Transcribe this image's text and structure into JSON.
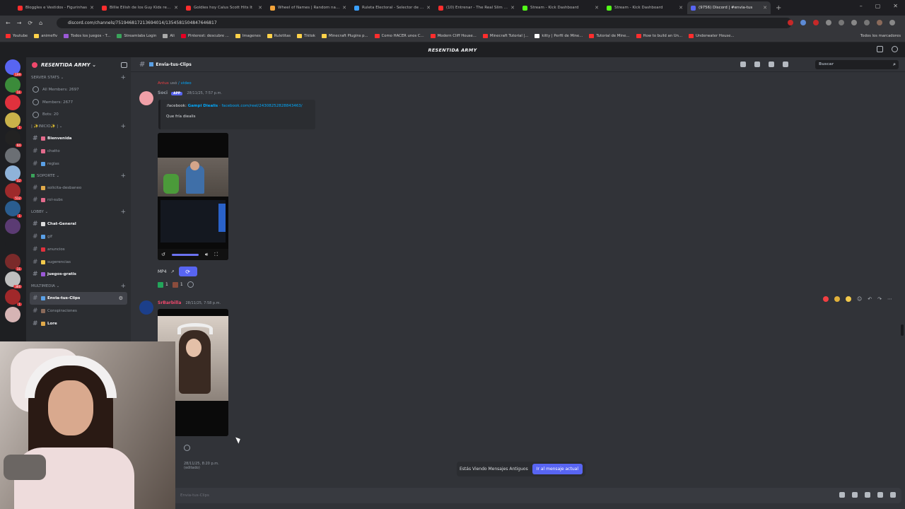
{
  "browser": {
    "tabs": [
      {
        "title": "Bloggles e Vestidos - Figurinhas",
        "color": "#ff2d2d",
        "active": false
      },
      {
        "title": "Billie Eilish de los Guy Kids regalo",
        "color": "#ff2d2d",
        "active": false
      },
      {
        "title": "Goldies hoy Calus Scott Hits It",
        "color": "#ff2d2d",
        "active": false
      },
      {
        "title": "Wheel of Names | Random name",
        "color": "#f2a33a",
        "active": false
      },
      {
        "title": "Ruleta Electoral - Selector de Persona",
        "color": "#3aa0ff",
        "active": false
      },
      {
        "title": "(10) Entrenar - The Real Slim Sh",
        "color": "#ff2d2d",
        "active": false
      },
      {
        "title": "Stream - Kick Dashboard",
        "color": "#53fc18",
        "active": false
      },
      {
        "title": "Stream - Kick Dashboard",
        "color": "#53fc18",
        "active": false
      },
      {
        "title": "(9756) Discord | #envia-tus",
        "color": "#5865f2",
        "active": true
      }
    ],
    "url": "discord.com/channels/751946817213694014/1354581504847646817",
    "bookmarks": [
      "Youtube",
      "animeflv",
      "Todos los juegos - T...",
      "Streamlabs Login",
      "Ali",
      "Pinterest: descubre ...",
      "Imagenes",
      "Ruletitas",
      "Tiktok",
      "Minecraft Plugins p...",
      "Como HACER unos C...",
      "Modern Cliff House...",
      "Minecraft Tutorial |...",
      "kitty | Perfil de Mine...",
      "Tutorial de Mine...",
      "How to build an Un...",
      "Underwater House..."
    ],
    "bookmarks_all": "Todos los marcadores"
  },
  "app": {
    "title": "RESENTIDA ARMY"
  },
  "servers": [
    {
      "color": "#5865f2",
      "badge": "199"
    },
    {
      "color": "#3b8b3a",
      "badge": "11"
    },
    {
      "color": "#e0313d",
      "badge": ""
    },
    {
      "color": "#c9b24a",
      "badge": "1"
    },
    {
      "color": "#222",
      "badge": "94"
    },
    {
      "color": "#6b6f74",
      "badge": ""
    },
    {
      "color": "#8fb3d9",
      "badge": "32"
    },
    {
      "color": "#9e2a2b",
      "badge": "512"
    },
    {
      "color": "#2a5d8f",
      "badge": "1"
    },
    {
      "color": "#5b3b73",
      "badge": ""
    },
    {
      "color": "#1e1f22",
      "badge": ""
    },
    {
      "color": "#7a2a2a",
      "badge": "11"
    },
    {
      "color": "#bfbfbf",
      "badge": "366"
    },
    {
      "color": "#a0282a",
      "badge": "1"
    },
    {
      "color": "#d6b4b4",
      "badge": ""
    }
  ],
  "server_name": "RESENTIDA ARMY",
  "sidebar": {
    "stats_cat": "SERVER STATS",
    "stats": [
      "All Members: 2697",
      "Members: 2677",
      "Bots: 20"
    ],
    "cat_inicio": "| ✨INICIO✨ |",
    "inicio": [
      "Bienvenida",
      "chatto",
      "reglas"
    ],
    "cat_soporte": "SOPORTE",
    "soporte": [
      "solicita-desbaneo",
      "rol-subs"
    ],
    "cat_lobby": "LOBBY",
    "lobby": [
      "Chat-General",
      "gif",
      "anuncios",
      "sugerencias",
      "juegos-gratis"
    ],
    "cat_multimedia": "MULTIMEDIA",
    "multimedia": [
      "Envia-tus-Clips",
      "Conspiraciones",
      "Lore"
    ]
  },
  "channel": {
    "name": "Envia-tus-Clips",
    "search_placeholder": "Buscar"
  },
  "messages": {
    "reply_user": "Antus",
    "reply_verb": "usó",
    "reply_cmd": "/ video",
    "msg1_user": "Soci",
    "msg1_app": "APP",
    "msg1_time": "28/11/25, 7:57 p.m.",
    "embed_prefix": ":facebook:",
    "embed_title": "Gampi Diealis",
    "embed_link": "· facebook.com/reel/24308252828843463/",
    "embed_desc": "Que fría diealis",
    "video_label": "MP4",
    "react1": "1",
    "react2": "1",
    "msg2_user": "SrBarbilla",
    "msg2_time": "28/11/25, 7:58 p.m.",
    "msg3_time": "28/11/25, 8:20 p.m.",
    "msg3_partial": "(editado)"
  },
  "banner": {
    "text": "Estás Viendo Mensajes Antiguos",
    "button": "Ir al mensaje actual"
  },
  "input": {
    "placeholder": "Envia-tus-Clips"
  }
}
